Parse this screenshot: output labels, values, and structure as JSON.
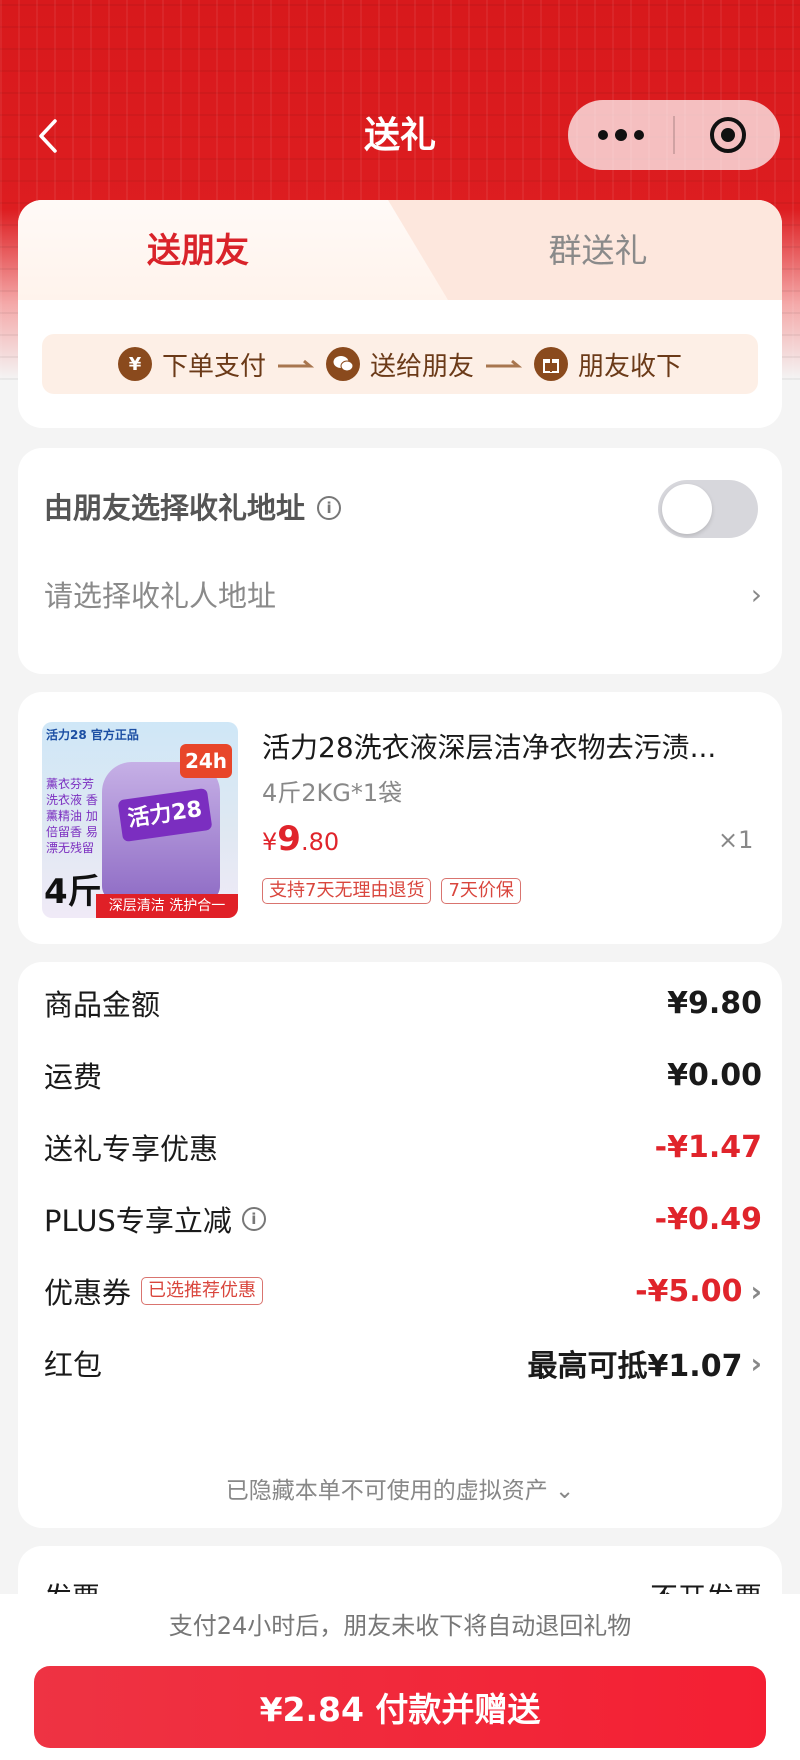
{
  "nav": {
    "title": "送礼",
    "back_icon": "chevron-left-icon",
    "more_icon": "more-dots-icon",
    "close_icon": "target-circle-icon"
  },
  "tabs": {
    "active": "送朋友",
    "other": "群送礼"
  },
  "flow": {
    "steps": [
      {
        "badge": "¥",
        "label": "下单支付",
        "icon": "yuan-icon"
      },
      {
        "badge": "",
        "label": "送给朋友",
        "icon": "wechat-icon"
      },
      {
        "badge": "",
        "label": "朋友收下",
        "icon": "gift-icon"
      }
    ]
  },
  "address": {
    "title": "由朋友选择收礼地址",
    "toggle_on": false,
    "placeholder": "请选择收礼人地址"
  },
  "product": {
    "name": "活力28洗衣液深层洁净衣物去污渍...",
    "spec": "4斤2KG*1袋",
    "price_currency": "¥",
    "price_int": "9",
    "price_dec": ".80",
    "qty": "×1",
    "tags": [
      "支持7天无理由退货",
      "7天价保"
    ],
    "image": {
      "brand": "活力28",
      "corner": "活力28 官方正品",
      "badge": "24h",
      "side_text": "薰衣芬芳 洗衣液 香薰精油 加倍留香 易漂无残留",
      "weight": "4斤",
      "strip": "深层清洁 洗护合一"
    }
  },
  "summary": {
    "rows": [
      {
        "label": "商品金额",
        "value": "¥9.80"
      },
      {
        "label": "运费",
        "value": "¥0.00"
      },
      {
        "label": "送礼专享优惠",
        "value": "-¥1.47"
      },
      {
        "label": "PLUS专享立减",
        "value": "-¥0.49"
      },
      {
        "label": "优惠券",
        "tag": "已选推荐优惠",
        "value": "-¥5.00"
      },
      {
        "label": "红包",
        "value": "最高可抵¥1.07"
      }
    ],
    "hidden_assets": "已隐藏本单不可使用的虚拟资产"
  },
  "invoice": {
    "label": "发票",
    "value": "不开发票"
  },
  "bottom": {
    "notice": "支付24小时后，朋友未收下将自动退回礼物",
    "pay_label": "¥2.84 付款并赠送"
  },
  "colors": {
    "brand_red": "#d9232a",
    "price_red": "#e0242b",
    "flow_brown": "#8a4a1d"
  }
}
